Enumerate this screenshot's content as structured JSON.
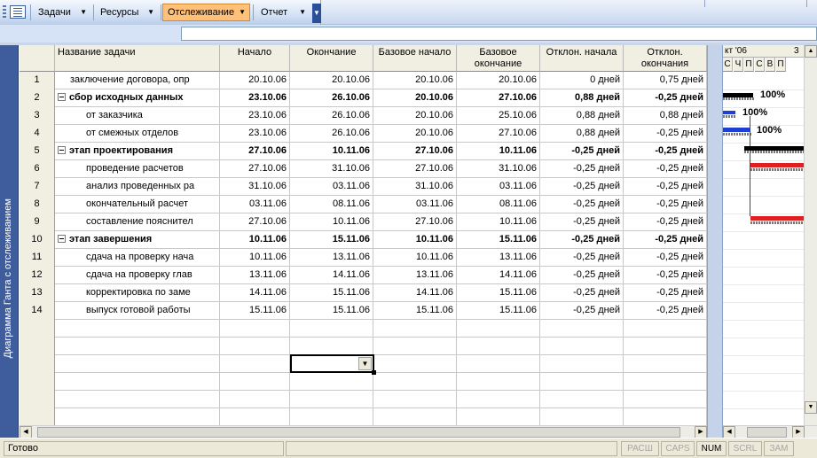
{
  "toolbar": {
    "tasks_label": "Задачи",
    "resources_label": "Ресурсы",
    "tracking_label": "Отслеживание",
    "report_label": "Отчет",
    "dropdown_arrow": "▼",
    "overflow_arrow": "▼"
  },
  "entry_bar": {
    "value": ""
  },
  "view_bar": {
    "label": "Диаграмма Ганта с отслеживанием"
  },
  "table": {
    "columns": [
      "",
      "Название задачи",
      "Начало",
      "Окончание",
      "Базовое начало",
      "Базовое окончание",
      "Отклон. начала",
      "Отклон. окончания"
    ],
    "rows": [
      {
        "id": "1",
        "name": "заключение договора, опр",
        "start": "20.10.06",
        "finish": "20.10.06",
        "bstart": "20.10.06",
        "bfinish": "20.10.06",
        "sv": "0 дней",
        "fv": "0,75 дней",
        "summary": false,
        "indent": 1
      },
      {
        "id": "2",
        "name": "сбор исходных данных",
        "start": "23.10.06",
        "finish": "26.10.06",
        "bstart": "20.10.06",
        "bfinish": "27.10.06",
        "sv": "0,88 дней",
        "fv": "-0,25 дней",
        "summary": true,
        "indent": 0
      },
      {
        "id": "3",
        "name": "от заказчика",
        "start": "23.10.06",
        "finish": "26.10.06",
        "bstart": "20.10.06",
        "bfinish": "25.10.06",
        "sv": "0,88 дней",
        "fv": "0,88 дней",
        "summary": false,
        "indent": 2
      },
      {
        "id": "4",
        "name": "от смежных отделов",
        "start": "23.10.06",
        "finish": "26.10.06",
        "bstart": "20.10.06",
        "bfinish": "27.10.06",
        "sv": "0,88 дней",
        "fv": "-0,25 дней",
        "summary": false,
        "indent": 2
      },
      {
        "id": "5",
        "name": "этап проектирования",
        "start": "27.10.06",
        "finish": "10.11.06",
        "bstart": "27.10.06",
        "bfinish": "10.11.06",
        "sv": "-0,25 дней",
        "fv": "-0,25 дней",
        "summary": true,
        "indent": 0
      },
      {
        "id": "6",
        "name": "проведение расчетов",
        "start": "27.10.06",
        "finish": "31.10.06",
        "bstart": "27.10.06",
        "bfinish": "31.10.06",
        "sv": "-0,25 дней",
        "fv": "-0,25 дней",
        "summary": false,
        "indent": 2
      },
      {
        "id": "7",
        "name": "анализ проведенных ра",
        "start": "31.10.06",
        "finish": "03.11.06",
        "bstart": "31.10.06",
        "bfinish": "03.11.06",
        "sv": "-0,25 дней",
        "fv": "-0,25 дней",
        "summary": false,
        "indent": 2
      },
      {
        "id": "8",
        "name": "окончательный расчет",
        "start": "03.11.06",
        "finish": "08.11.06",
        "bstart": "03.11.06",
        "bfinish": "08.11.06",
        "sv": "-0,25 дней",
        "fv": "-0,25 дней",
        "summary": false,
        "indent": 2
      },
      {
        "id": "9",
        "name": "составление пояснител",
        "start": "27.10.06",
        "finish": "10.11.06",
        "bstart": "27.10.06",
        "bfinish": "10.11.06",
        "sv": "-0,25 дней",
        "fv": "-0,25 дней",
        "summary": false,
        "indent": 2
      },
      {
        "id": "10",
        "name": "этап завершения",
        "start": "10.11.06",
        "finish": "15.11.06",
        "bstart": "10.11.06",
        "bfinish": "15.11.06",
        "sv": "-0,25 дней",
        "fv": "-0,25 дней",
        "summary": true,
        "indent": 0
      },
      {
        "id": "11",
        "name": "сдача на проверку нача",
        "start": "10.11.06",
        "finish": "13.11.06",
        "bstart": "10.11.06",
        "bfinish": "13.11.06",
        "sv": "-0,25 дней",
        "fv": "-0,25 дней",
        "summary": false,
        "indent": 2
      },
      {
        "id": "12",
        "name": "сдача на проверку глав",
        "start": "13.11.06",
        "finish": "14.11.06",
        "bstart": "13.11.06",
        "bfinish": "14.11.06",
        "sv": "-0,25 дней",
        "fv": "-0,25 дней",
        "summary": false,
        "indent": 2
      },
      {
        "id": "13",
        "name": "корректировка по заме",
        "start": "14.11.06",
        "finish": "15.11.06",
        "bstart": "14.11.06",
        "bfinish": "15.11.06",
        "sv": "-0,25 дней",
        "fv": "-0,25 дней",
        "summary": false,
        "indent": 2
      },
      {
        "id": "14",
        "name": "выпуск готовой работы",
        "start": "15.11.06",
        "finish": "15.11.06",
        "bstart": "15.11.06",
        "bfinish": "15.11.06",
        "sv": "-0,25 дней",
        "fv": "-0,25 дней",
        "summary": false,
        "indent": 2
      }
    ]
  },
  "gantt": {
    "month_label": "кт '06",
    "next_month_label": "3",
    "days": [
      "С",
      "Ч",
      "П",
      "С",
      "В",
      "П"
    ],
    "progress_labels": [
      "100%",
      "100%",
      "100%"
    ],
    "colors": {
      "summary": "#000000",
      "task": "#1f3fd0",
      "critical": "#e02020",
      "baseline": "#808080"
    }
  },
  "status": {
    "text": "Готово",
    "indicators": [
      {
        "label": "РАСШ",
        "on": false
      },
      {
        "label": "CAPS",
        "on": false
      },
      {
        "label": "NUM",
        "on": true
      },
      {
        "label": "SCRL",
        "on": false
      },
      {
        "label": "ЗАМ",
        "on": false
      }
    ]
  },
  "icons": [
    "grip-icon",
    "gantt-view-icon",
    "chevron-down-icon",
    "scroll-left-icon",
    "scroll-right-icon",
    "scroll-up-icon",
    "scroll-down-icon"
  ]
}
